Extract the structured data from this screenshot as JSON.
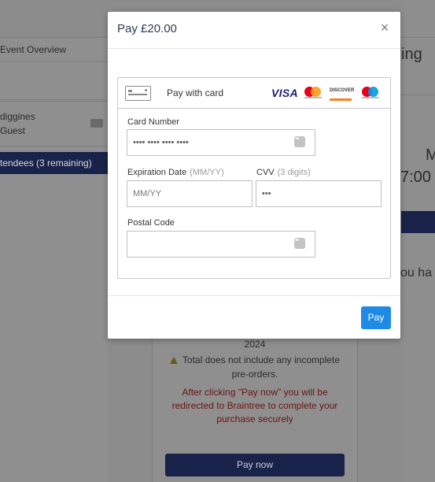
{
  "background": {
    "left_nav": {
      "event_overview": "Event Overview",
      "guest_line1": "diggines",
      "guest_line2": "Guest",
      "attendees": "tendees (3 remaining)"
    },
    "right_fragments": {
      "heading_fragment": "ing",
      "m_fragment": "M",
      "time_fragment": "7:00",
      "you_fragment": "ou ha"
    },
    "center": {
      "year": "2024",
      "warning": "Total does not include any incomplete pre-orders.",
      "redirect_notice": "After clicking \"Pay now\" you will be redirected to Braintree to complete your purchase securely",
      "pay_now_label": "Pay now"
    }
  },
  "modal": {
    "title": "Pay £20.00",
    "close_glyph": "×",
    "card_header_label": "Pay with card",
    "brands": {
      "visa": "VISA",
      "discover": "DISCOVER"
    },
    "card_number": {
      "label": "Card Number",
      "value": "•••• •••• •••• ••••"
    },
    "expiration": {
      "label": "Expiration Date",
      "hint": "(MM/YY)",
      "placeholder": "MM/YY"
    },
    "cvv": {
      "label": "CVV",
      "hint": "(3 digits)",
      "value": "•••"
    },
    "postal_code": {
      "label": "Postal Code",
      "value": ""
    },
    "pay_button": "Pay"
  },
  "colors": {
    "overlay": "#8c8c8c",
    "navy": "#192249",
    "pay_blue": "#1e8ae6",
    "title_text": "#2d3b57",
    "error_red": "#6a1414"
  }
}
